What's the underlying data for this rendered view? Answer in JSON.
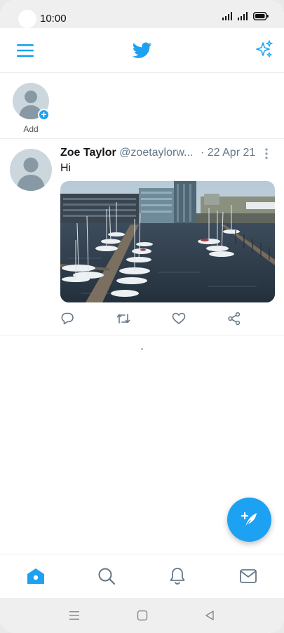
{
  "status_bar": {
    "time": "10:00",
    "icons": [
      "signal-icon",
      "signal-icon",
      "battery-icon"
    ]
  },
  "app_bar": {
    "menu_icon": "menu-icon",
    "logo_icon": "twitter-bird-icon",
    "sparkle_icon": "sparkle-icon"
  },
  "fleets": {
    "add_label": "Add"
  },
  "tweet": {
    "name": "Zoe Taylor",
    "handle": "@zoetaylorw...",
    "date": "· 22 Apr 21",
    "text": "Hi",
    "media": "harbor-photo",
    "actions": [
      "reply-icon",
      "retweet-icon",
      "like-icon",
      "share-icon"
    ]
  },
  "fab": {
    "icon": "compose-icon"
  },
  "bottom_nav": {
    "items": [
      "home-icon",
      "search-icon",
      "bell-icon",
      "mail-icon"
    ]
  },
  "system_nav": {
    "items": [
      "recents-icon",
      "home-square-icon",
      "back-icon"
    ]
  },
  "colors": {
    "accent": "#1da1f2",
    "text": "#14171a",
    "muted": "#657786"
  }
}
